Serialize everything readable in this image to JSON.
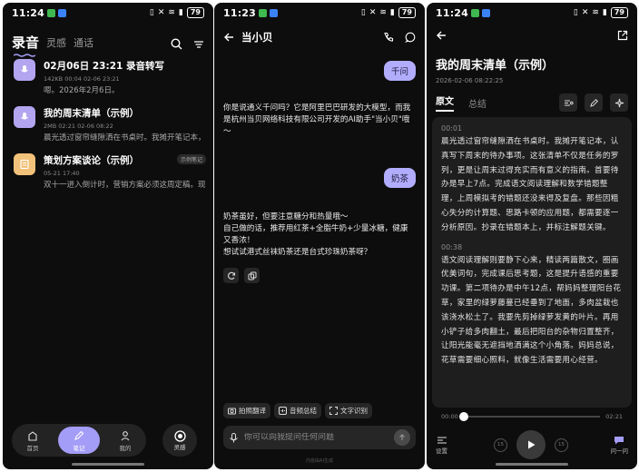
{
  "phone1": {
    "status": {
      "time": "11:24",
      "battery": "79"
    },
    "header": {
      "title": "录音",
      "tabs": [
        "灵感",
        "通话"
      ]
    },
    "records": [
      {
        "title": "02月06日 23:21 录音转写",
        "meta": "142KB  00:04  02-06 23:21",
        "snippet": "嗯。2026年2月6日。",
        "badge": ""
      },
      {
        "title": "我的周末清单（示例）",
        "meta": "2MB  02:21  02-06 08:22",
        "snippet": "晨光透过窗帘缝隙洒在书桌时。我摊开笔记本，",
        "badge": ""
      },
      {
        "title": "策划方案谈论（示例）",
        "meta": "05-21 17:40",
        "snippet": "双十一进入倒计时，营销方案必须这周定稿。现...",
        "badge": "示例笔记"
      }
    ],
    "nav": {
      "home": "首页",
      "notes": "笔记",
      "me": "我的",
      "inspire": "灵感"
    }
  },
  "phone2": {
    "status": {
      "time": "11:23",
      "battery": "79"
    },
    "header": {
      "name": "当小贝"
    },
    "msg_user_1": "千问",
    "msg_ai_1": "你是说通义千问吗？它是阿里巴巴研发的大模型，而我是杭州当贝网络科技有限公司开发的AI助手\"当小贝\"哦～",
    "msg_user_2": "奶茶",
    "msg_ai_2_lines": [
      "奶茶虽好，但要注意糖分和热量哦～",
      "自己做的话，推荐用红茶+全脂牛奶+少量冰糖，健康又香浓！",
      "想试试港式丝袜奶茶还是台式珍珠奶茶呀？"
    ],
    "chips": [
      "拍照翻译",
      "音频总结",
      "文字识别"
    ],
    "input_placeholder": "你可以向我提问任何问题",
    "disclaimer": "内容由AI生成"
  },
  "phone3": {
    "status": {
      "time": "11:24",
      "battery": "79"
    },
    "title": "我的周末清单（示例）",
    "date": "2026-02-06 08:22:25",
    "tabs": [
      "原文",
      "总结"
    ],
    "segments": [
      {
        "time": "00:01",
        "text": "晨光透过窗帘缝隙洒在书桌时。我摊开笔记本，认真写下周末的待办事项。这张清单不仅是任务的罗列，更是让周末过得充实而有意义的指南。首要待办是早上7点。完成语文阅读理解和数学错题整理，上周模拟考的错题还没来得及复盘。那些因粗心失分的计算题、思路卡顿的应用题，都需要逐一分析原因。抄录在错题本上，并标注解题关键。"
      },
      {
        "time": "00:38",
        "text": "语文阅读理解则要静下心来，精读两篇散文，圈画优美词句，完成课后思考题，这是提升语感的重要功课。第二项待办是中午12点，帮妈妈整理阳台花草，家里的绿萝藤蔓已经垂到了地面，多肉盆栽也该浇水松土了。我要先剪掉绿萝发黄的叶片。再用小铲子给多肉翻土，最后把阳台的杂物归置整齐，让阳光能毫无遮挡地洒满这个小角落。妈妈总说，花草需要细心照料，就像生活需要用心经营。"
      }
    ],
    "player": {
      "current": "00:00",
      "total": "02:21",
      "progress_pct": 0,
      "settings": "设置",
      "back": "15",
      "fwd": "15",
      "ask": "问一问"
    }
  },
  "colors": {
    "accent": "#a49df7",
    "bubble": "#b1adfc",
    "bg": "#0d0d0d",
    "card": "#1e1e1e"
  }
}
